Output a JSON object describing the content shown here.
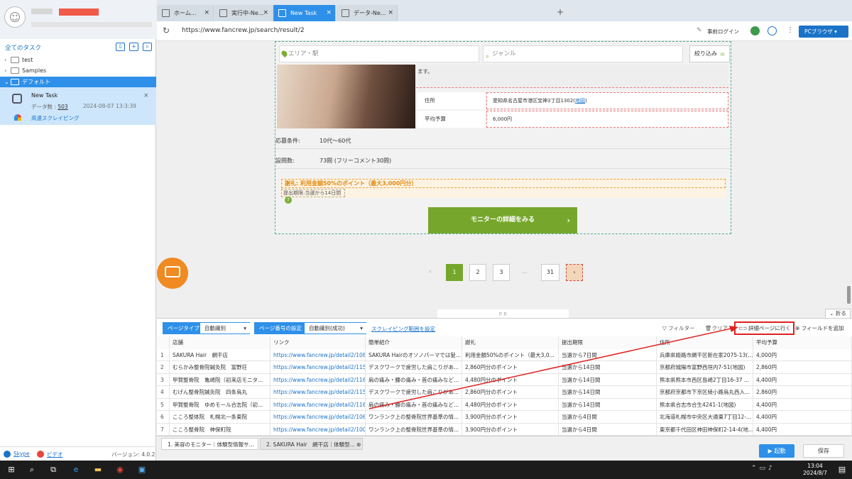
{
  "left": {
    "all_tasks": "全てのタスク",
    "tree": [
      {
        "label": "test"
      },
      {
        "label": "Samples"
      },
      {
        "label": "デフォルト"
      }
    ],
    "task": {
      "name": "New Task",
      "data_label": "データ数 :",
      "data_count": "503",
      "date": "2024-08-07 13:3:39",
      "fast": "高速スクレイピング"
    },
    "footer": {
      "skype": "Skype",
      "video": "ビデオ",
      "version": "バージョン: 4.0.2"
    }
  },
  "tabs": [
    {
      "label": "ホーム..."
    },
    {
      "label": "実行中-Ne..."
    },
    {
      "label": "New Task"
    },
    {
      "label": "データ-Ne..."
    }
  ],
  "address": {
    "url": "https://www.fancrew.jp/search/result/2",
    "login": "事前ログイン",
    "browser": "PCブラウザ"
  },
  "web": {
    "area_placeholder": "エリア・駅",
    "genre_placeholder": "ジャンル",
    "filter": "絞り込み",
    "desc": "ます。",
    "address_key": "住所",
    "address_val": "愛知県名古屋市港区宝神3丁目1302(",
    "map": "地図",
    "address_tail": ")",
    "budget_key": "平均予算",
    "budget_val": "6,000円",
    "cond1_key": "応募条件:",
    "cond1_val": "10代〜60代",
    "cond2_key": "設問数:",
    "cond2_val": "73問 (フリーコメント30問)",
    "reward": "謝礼: 利用金額50%のポイント（最大3,000円分）",
    "deadline": "提出期限:当選から14日間",
    "more": "モニターの詳細をみる",
    "pages": [
      "1",
      "2",
      "3",
      "...",
      "31"
    ],
    "pr": "P R",
    "fold": "折る"
  },
  "toolbar": {
    "page_type_label": "ページタイプ",
    "page_type_val": "自動識別",
    "page_num_label": "ページ番号の設定",
    "page_num_val": "自動識別(成功)",
    "scrape_range": "スクレイピング範囲を設定",
    "filter": "フィルター",
    "delete": "クリア",
    "detail": "詳細ページに行く",
    "add_field": "フィールドを追加"
  },
  "table": {
    "headers": [
      "",
      "店舗",
      "リンク",
      "簡単紹介",
      "謝礼",
      "提出期限",
      "住所",
      "平均予算"
    ],
    "rows": [
      [
        "1",
        "SAKURA Hair　網干店",
        "https://www.fancrew.jp/detail2/10894...",
        "SAKURA Hairのオソノパーマでは髪...",
        "利用金額50%のポイント（最大3,0...",
        "当選から7日間",
        "兵庫県姫路市網干区新在家2075-13(...",
        "4,000円"
      ],
      [
        "2",
        "むらかみ整骨院鍼灸院　富野荘",
        "https://www.fancrew.jp/detail2/11550...",
        "デスクワークで疲労した肩こりがあ...",
        "2,860円分のポイント",
        "当選から14日間",
        "京都府城陽市富野西垣内7-51(地図)",
        "2,860円"
      ],
      [
        "3",
        "甲賀整骨院　亀崎院（初来店モニタ...",
        "https://www.fancrew.jp/detail2/11625...",
        "肩の痛み・腰の痛み・首の痛みなど...",
        "4,480円分のポイント",
        "当選から14日間",
        "熊本県熊本市西区島崎2丁目16-37 ...",
        "4,400円"
      ],
      [
        "4",
        "むげん整骨院鍼灸院　四条烏丸",
        "https://www.fancrew.jp/detail2/11551...",
        "デスクワークで疲労した肩こりがあ...",
        "2,860円分のポイント",
        "当選から14日間",
        "京都府京都市下京区綾小路烏丸西入...",
        "2,860円"
      ],
      [
        "5",
        "甲賀整骨院　ゆめモール合志院（初...",
        "https://www.fancrew.jp/detail2/11624...",
        "肩の痛み・腰の痛み・首の痛みなど...",
        "4,480円分のポイント",
        "当選から14日間",
        "熊本県合志市合生4241-1(地図)",
        "4,400円"
      ],
      [
        "6",
        "こころ整体院　札幌北一条東院",
        "https://www.fancrew.jp/detail2/10675...",
        "ワンランク上の整骨院世界基準の情...",
        "3,900円分のポイント",
        "当選から4日間",
        "北海道札幌市中央区大通東7丁目12-...",
        "4,400円"
      ],
      [
        "7",
        "こころ整骨院　神保町院",
        "https://www.fancrew.jp/detail2/10036...",
        "ワンランク上の整骨院世界基準の情...",
        "3,900円分のポイント",
        "当選から4日間",
        "東京都千代田区神田神保町2-14-4(地...",
        "4,400円"
      ]
    ]
  },
  "bottom_tabs": [
    "1. 美容のモニター｜体験型情報サ...",
    "2. SAKURA Hair　網干店｜体験型..."
  ],
  "buttons": {
    "start": "起動",
    "save": "保存"
  },
  "clock": {
    "time": "13:04",
    "date": "2024/8/7"
  },
  "colors": {
    "accent": "#2e90e8",
    "site_green": "#76a72c",
    "highlight": "#e02020"
  }
}
